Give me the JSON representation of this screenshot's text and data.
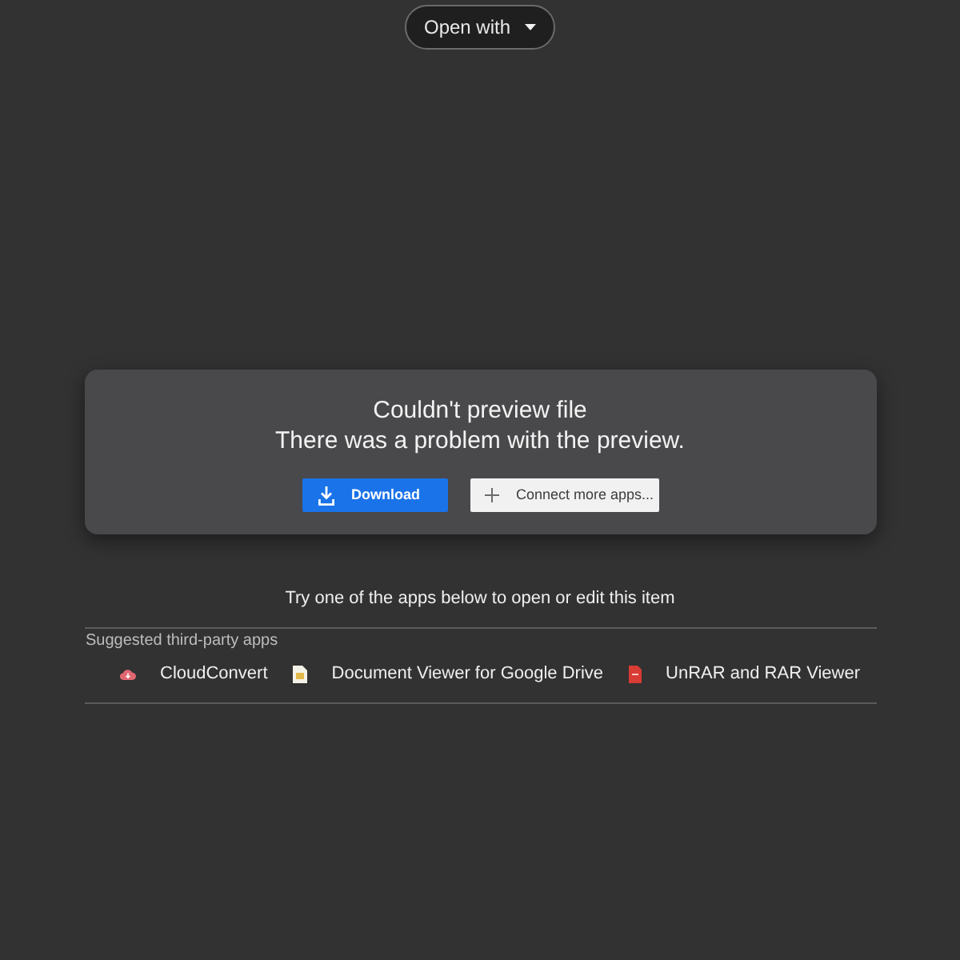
{
  "open_with": {
    "label": "Open with"
  },
  "error_card": {
    "title": "Couldn't preview file",
    "message": "There was a problem with the preview.",
    "buttons": [
      {
        "kind": "primary",
        "label": "Download"
      },
      {
        "kind": "secondary",
        "label": "Connect more apps..."
      }
    ]
  },
  "hint": "Try one of the apps below to open or edit this item",
  "suggested_apps": {
    "heading": "Suggested third-party apps",
    "apps": [
      {
        "kind": "cloud",
        "label": "CloudConvert"
      },
      {
        "kind": "document",
        "label": "Document Viewer for Google Drive"
      },
      {
        "kind": "archive",
        "label": "UnRAR and RAR Viewer"
      }
    ]
  }
}
